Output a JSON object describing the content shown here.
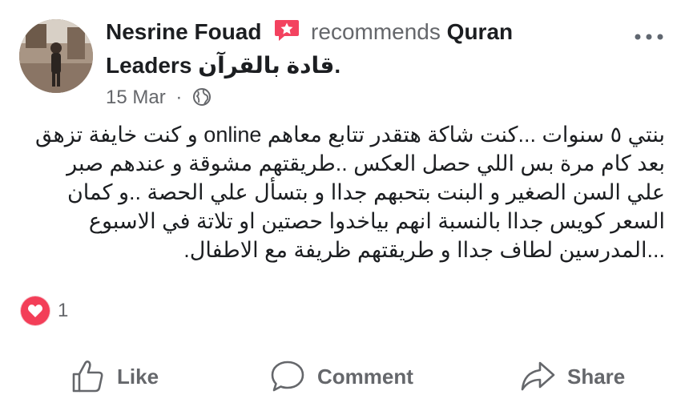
{
  "post": {
    "author": "Nesrine Fouad",
    "recommends_text": "recommends",
    "page_name_line1": "Quran",
    "page_name_line2_en": "Leaders",
    "page_name_line2_ar": "قادة بالقرآن",
    "page_name_period": ".",
    "date": "15 Mar",
    "meta_separator": "·",
    "audience_icon": "globe-icon",
    "body": "بنتي ٥ سنوات ...كنت شاكة هتقدر تتابع معاهم online و كنت خايفة تزهق بعد كام مرة بس اللي حصل العكس ..طريقتهم مشوقة و عندهم صبر علي السن الصغير و البنت بتحبهم جداا و بتسأل علي الحصة ..و كمان السعر كويس جداا بالنسبة انهم بياخدوا حصتين او تلاتة في الاسبوع ...المدرسين لطاف جداا و طريقتهم ظريفة مع الاطفال."
  },
  "reactions": {
    "icon": "heart-icon",
    "count": "1"
  },
  "actions": {
    "like_label": "Like",
    "comment_label": "Comment",
    "share_label": "Share"
  },
  "colors": {
    "recommend_badge": "#f3425f",
    "love_reaction": "#f33e58",
    "secondary_text": "#65676b"
  }
}
